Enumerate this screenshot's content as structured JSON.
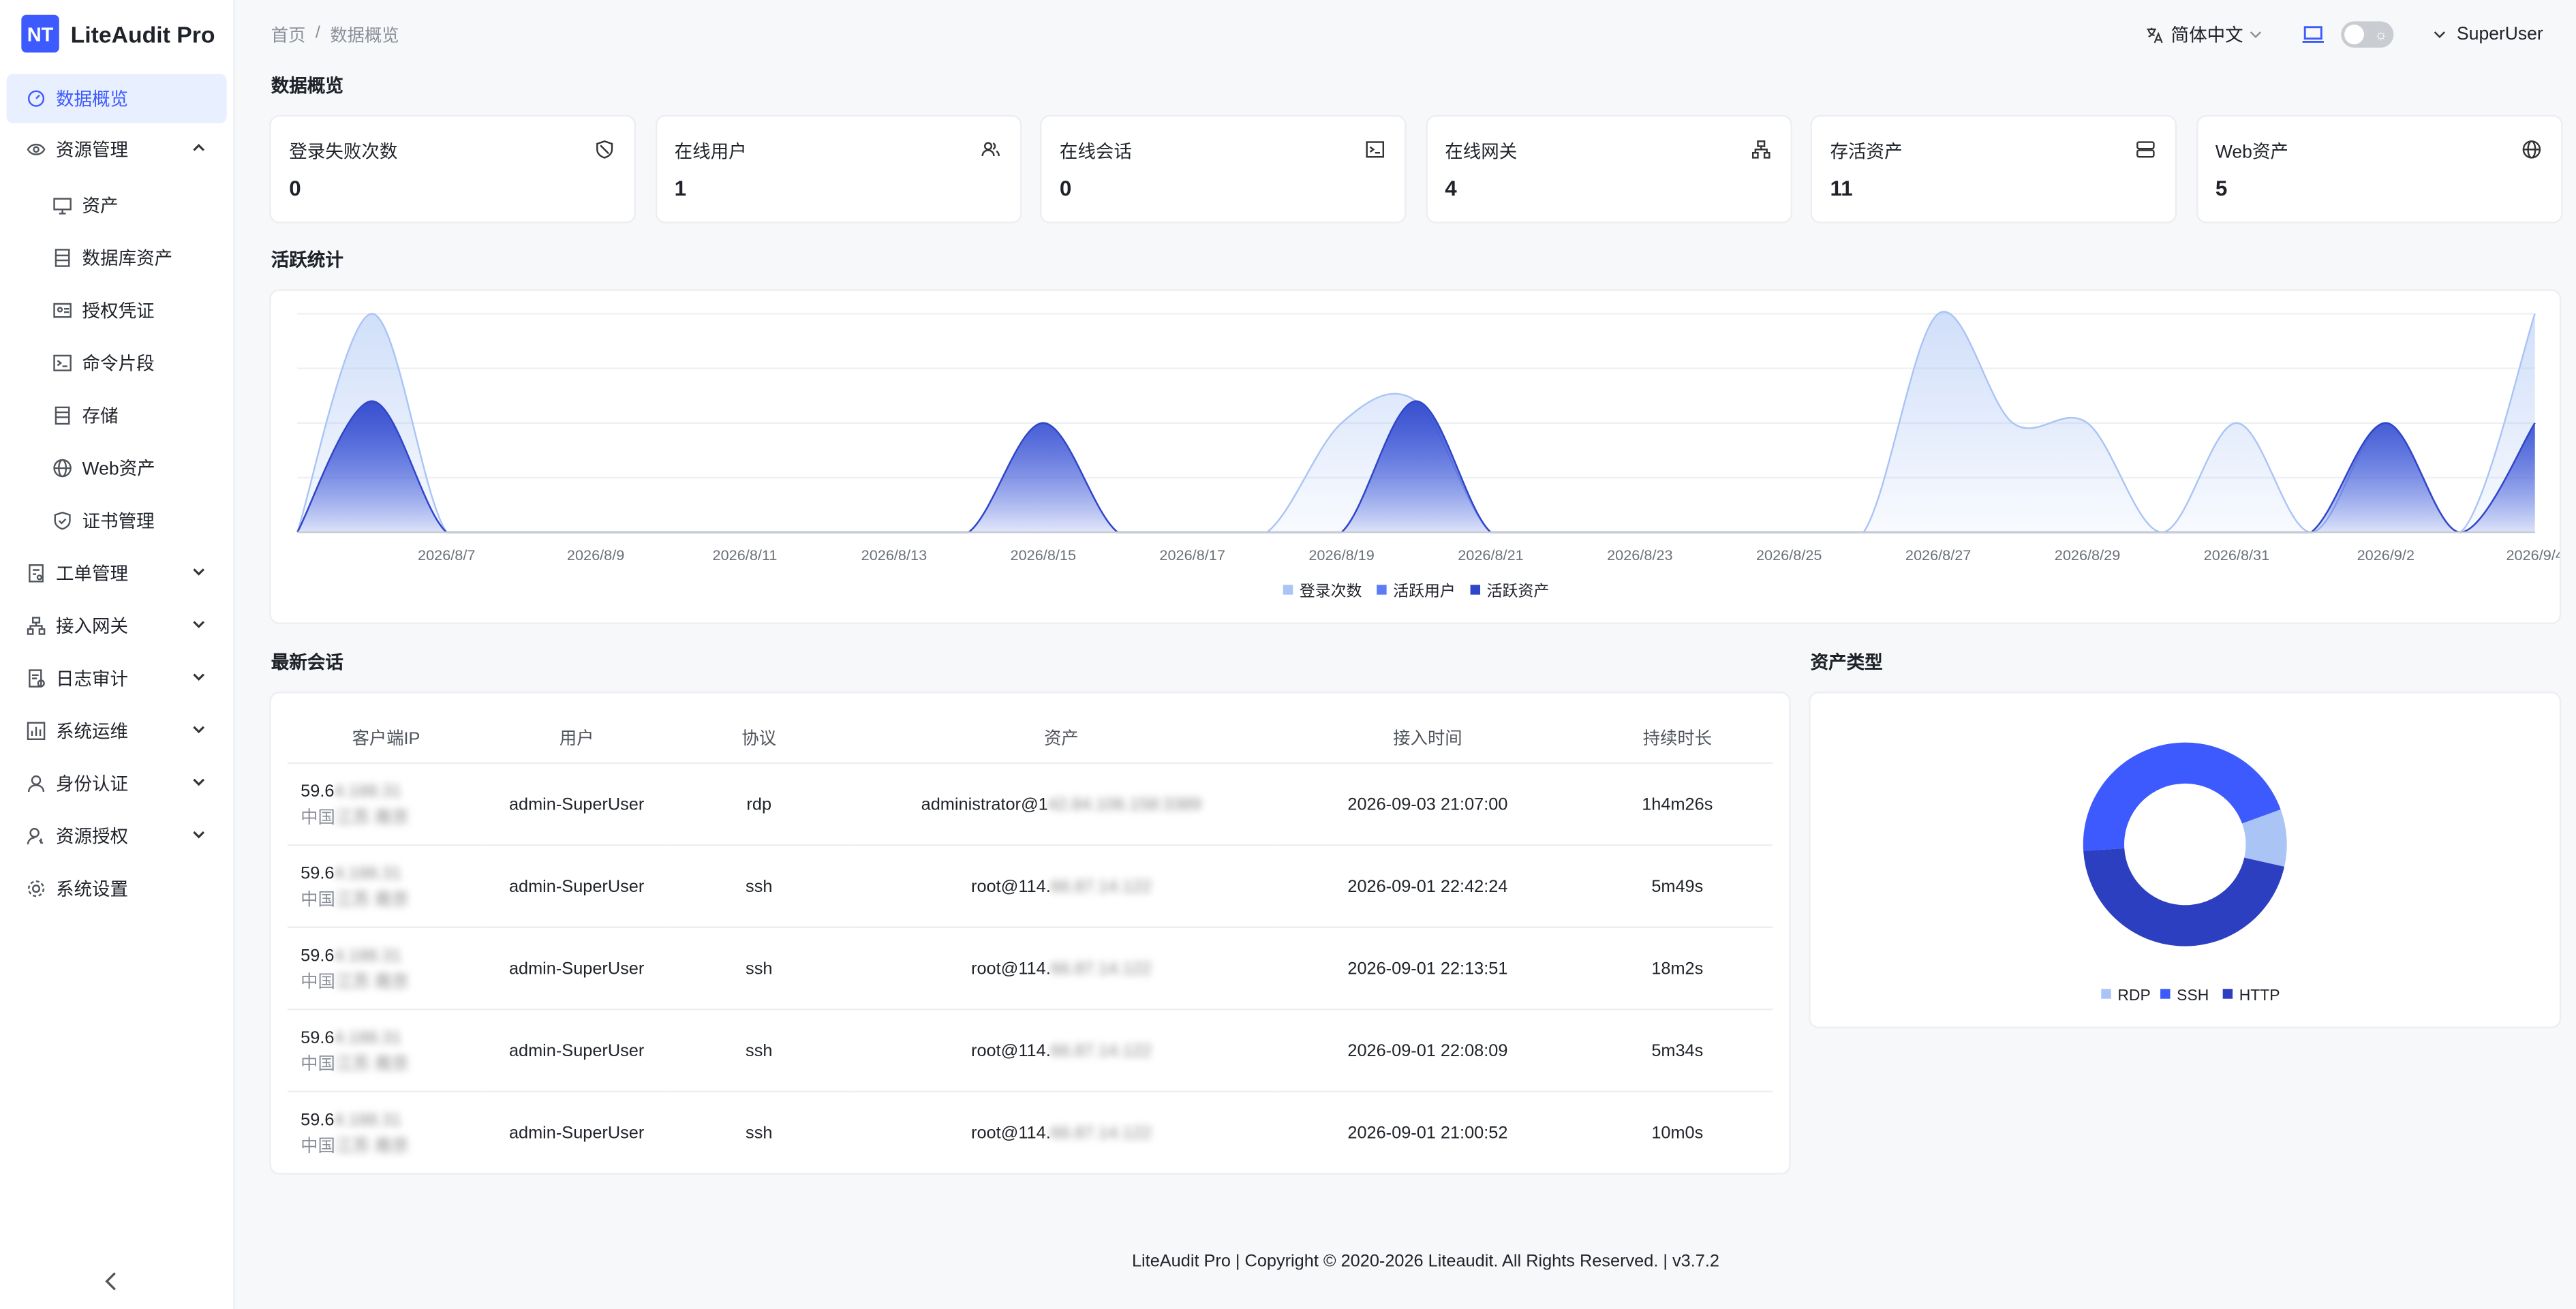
{
  "app": {
    "logo_badge": "NT",
    "name": "LiteAudit Pro"
  },
  "sidebar": {
    "items": [
      {
        "label": "数据概览",
        "icon": "dashboard-icon",
        "active": true
      },
      {
        "label": "资源管理",
        "icon": "resources-icon",
        "expanded": true
      },
      {
        "label": "资产",
        "icon": "monitor-icon",
        "sub": true
      },
      {
        "label": "数据库资产",
        "icon": "database-icon",
        "sub": true
      },
      {
        "label": "授权凭证",
        "icon": "id-card-icon",
        "sub": true
      },
      {
        "label": "命令片段",
        "icon": "terminal-icon",
        "sub": true
      },
      {
        "label": "存储",
        "icon": "storage-icon",
        "sub": true
      },
      {
        "label": "Web资产",
        "icon": "globe-icon",
        "sub": true
      },
      {
        "label": "证书管理",
        "icon": "shield-check-icon",
        "sub": true
      },
      {
        "label": "工单管理",
        "icon": "ticket-icon",
        "expanded": false
      },
      {
        "label": "接入网关",
        "icon": "gateway-icon",
        "expanded": false
      },
      {
        "label": "日志审计",
        "icon": "audit-log-icon",
        "expanded": false
      },
      {
        "label": "系统运维",
        "icon": "ops-icon",
        "expanded": false
      },
      {
        "label": "身份认证",
        "icon": "user-icon",
        "expanded": false
      },
      {
        "label": "资源授权",
        "icon": "user-key-icon",
        "expanded": false
      },
      {
        "label": "系统设置",
        "icon": "gear-icon"
      }
    ]
  },
  "header": {
    "breadcrumb": {
      "home": "首页",
      "separator": "/",
      "current": "数据概览"
    },
    "language": "简体中文",
    "user": "SuperUser"
  },
  "overview": {
    "title": "数据概览",
    "stats": [
      {
        "label": "登录失败次数",
        "value": "0",
        "icon": "ban-icon"
      },
      {
        "label": "在线用户",
        "value": "1",
        "icon": "users-icon"
      },
      {
        "label": "在线会话",
        "value": "0",
        "icon": "terminal-icon"
      },
      {
        "label": "在线网关",
        "value": "4",
        "icon": "gateway-icon"
      },
      {
        "label": "存活资产",
        "value": "11",
        "icon": "server-icon"
      },
      {
        "label": "Web资产",
        "value": "5",
        "icon": "globe-icon"
      }
    ]
  },
  "activity": {
    "title": "活跃统计",
    "chart_data": {
      "type": "area",
      "x": [
        "2026/8/5",
        "2026/8/6",
        "2026/8/7",
        "2026/8/8",
        "2026/8/9",
        "2026/8/10",
        "2026/8/11",
        "2026/8/12",
        "2026/8/13",
        "2026/8/14",
        "2026/8/15",
        "2026/8/16",
        "2026/8/17",
        "2026/8/18",
        "2026/8/19",
        "2026/8/20",
        "2026/8/21",
        "2026/8/22",
        "2026/8/23",
        "2026/8/24",
        "2026/8/25",
        "2026/8/26",
        "2026/8/27",
        "2026/8/28",
        "2026/8/29",
        "2026/8/30",
        "2026/8/31",
        "2026/9/1",
        "2026/9/2",
        "2026/9/3",
        "2026/9/4"
      ],
      "tick_labels": [
        "2026/8/7",
        "2026/8/9",
        "2026/8/11",
        "2026/8/13",
        "2026/8/15",
        "2026/8/17",
        "2026/8/19",
        "2026/8/21",
        "2026/8/23",
        "2026/8/25",
        "2026/8/27",
        "2026/8/29",
        "2026/8/31",
        "2026/9/2",
        "2026/9/4"
      ],
      "series": [
        {
          "name": "登录次数",
          "color": "#a9c4f5",
          "values": [
            0,
            20,
            0,
            0,
            0,
            0,
            0,
            0,
            0,
            0,
            0,
            0,
            0,
            0,
            10,
            12,
            0,
            0,
            0,
            0,
            0,
            0,
            20,
            10,
            10,
            0,
            10,
            0,
            10,
            0,
            20
          ]
        },
        {
          "name": "活跃用户",
          "color": "#5b7cf5",
          "values": [
            0,
            12,
            0,
            0,
            0,
            0,
            0,
            0,
            0,
            0,
            10,
            0,
            0,
            0,
            0,
            12,
            0,
            0,
            0,
            0,
            0,
            0,
            0,
            0,
            0,
            0,
            0,
            0,
            10,
            0,
            10
          ]
        },
        {
          "name": "活跃资产",
          "color": "#3046c8",
          "values": [
            0,
            12,
            0,
            0,
            0,
            0,
            0,
            0,
            0,
            0,
            10,
            0,
            0,
            0,
            0,
            12,
            0,
            0,
            0,
            0,
            0,
            0,
            0,
            0,
            0,
            0,
            0,
            0,
            10,
            0,
            10
          ]
        }
      ],
      "ylim": [
        0,
        20
      ],
      "grid": true,
      "legend": "bottom-center"
    }
  },
  "sessions": {
    "title": "最新会话",
    "columns": [
      "客户端IP",
      "用户",
      "协议",
      "资产",
      "接入时间",
      "持续时长"
    ],
    "rows": [
      {
        "ip": "59.6",
        "ip_masked": "4.188.31",
        "geo": "中国",
        "geo_masked": "江苏 南京",
        "user": "admin-SuperUser",
        "protocol": "rdp",
        "asset": "administrator@1",
        "asset_masked": "42.84.106.158:3389",
        "time": "2026-09-03 21:07:00",
        "duration": "1h4m26s"
      },
      {
        "ip": "59.6",
        "ip_masked": "4.188.31",
        "geo": "中国",
        "geo_masked": "江苏 南京",
        "user": "admin-SuperUser",
        "protocol": "ssh",
        "asset": "root@114.",
        "asset_masked": "66.87.14.122",
        "time": "2026-09-01 22:42:24",
        "duration": "5m49s"
      },
      {
        "ip": "59.6",
        "ip_masked": "4.188.31",
        "geo": "中国",
        "geo_masked": "江苏 南京",
        "user": "admin-SuperUser",
        "protocol": "ssh",
        "asset": "root@114.",
        "asset_masked": "66.87.14.122",
        "time": "2026-09-01 22:13:51",
        "duration": "18m2s"
      },
      {
        "ip": "59.6",
        "ip_masked": "4.188.31",
        "geo": "中国",
        "geo_masked": "江苏 南京",
        "user": "admin-SuperUser",
        "protocol": "ssh",
        "asset": "root@114.",
        "asset_masked": "66.87.14.122",
        "time": "2026-09-01 22:08:09",
        "duration": "5m34s"
      },
      {
        "ip": "59.6",
        "ip_masked": "4.188.31",
        "geo": "中国",
        "geo_masked": "江苏 南京",
        "user": "admin-SuperUser",
        "protocol": "ssh",
        "asset": "root@114.",
        "asset_masked": "66.87.14.122",
        "time": "2026-09-01 21:00:52",
        "duration": "10m0s"
      }
    ]
  },
  "asset_types": {
    "title": "资产类型",
    "chart_data": {
      "type": "pie",
      "donut": true,
      "categories": [
        "RDP",
        "SSH",
        "HTTP"
      ],
      "values": [
        1,
        5,
        5
      ],
      "colors": [
        "#a9c4f5",
        "#3d5afe",
        "#2c3fc0"
      ],
      "legend": "bottom-center"
    }
  },
  "footer": {
    "text": "LiteAudit Pro | Copyright © 2020-2026 Liteaudit. All Rights Reserved. | v3.7.2"
  }
}
